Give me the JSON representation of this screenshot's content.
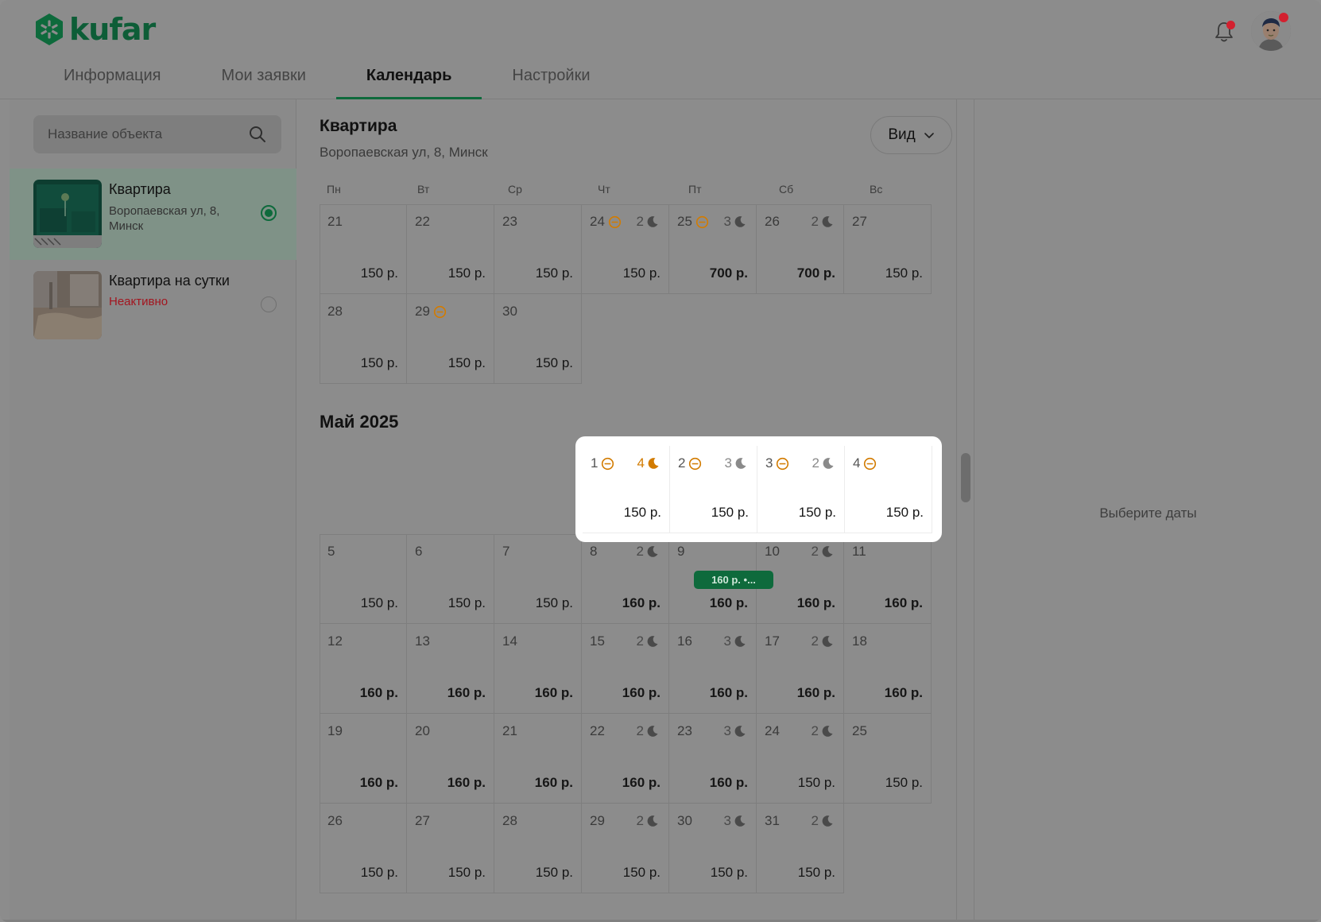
{
  "brand": {
    "name": "kufar",
    "color": "#0e6a3c"
  },
  "tabs": [
    {
      "label": "Информация",
      "active": false
    },
    {
      "label": "Мои заявки",
      "active": false
    },
    {
      "label": "Календарь",
      "active": true
    },
    {
      "label": "Настройки",
      "active": false
    }
  ],
  "sidebar": {
    "search_placeholder": "Название объекта",
    "objects": [
      {
        "title": "Квартира",
        "subtitle": "Воропаевская ул, 8, Минск",
        "selected": true
      },
      {
        "title": "Квартира на сутки",
        "status": "Неактивно",
        "selected": false
      }
    ]
  },
  "main": {
    "title": "Квартира",
    "address": "Воропаевская ул, 8, Минск",
    "view_label": "Вид",
    "weekdays": [
      "Пн",
      "Вт",
      "Ср",
      "Чт",
      "Пт",
      "Сб",
      "Вс"
    ],
    "month_title": "Май 2025",
    "badge_text": "160 р. •...",
    "april_rows": [
      [
        {
          "day": "21",
          "price": "150 р."
        },
        {
          "day": "22",
          "price": "150 р."
        },
        {
          "day": "23",
          "price": "150 р."
        },
        {
          "day": "24",
          "blocked": true,
          "nights": "2",
          "price": "150 р."
        },
        {
          "day": "25",
          "blocked": true,
          "nights": "3",
          "price": "700 р.",
          "bold": true
        },
        {
          "day": "26",
          "nights": "2",
          "price": "700 р.",
          "bold": true
        },
        {
          "day": "27",
          "price": "150 р."
        }
      ],
      [
        {
          "day": "28",
          "price": "150 р."
        },
        {
          "day": "29",
          "blocked": true,
          "price": "150 р."
        },
        {
          "day": "30",
          "price": "150 р."
        }
      ]
    ],
    "may_first_row": [
      {
        "day": "1",
        "blocked": true,
        "nights": "4",
        "nights_highlight": true,
        "price": "150 р."
      },
      {
        "day": "2",
        "blocked": true,
        "nights": "3",
        "price": "150 р."
      },
      {
        "day": "3",
        "blocked": true,
        "nights": "2",
        "price": "150 р."
      },
      {
        "day": "4",
        "blocked": true,
        "price": "150 р."
      }
    ],
    "may_rows": [
      [
        {
          "day": "5",
          "price": "150 р."
        },
        {
          "day": "6",
          "price": "150 р."
        },
        {
          "day": "7",
          "price": "150 р."
        },
        {
          "day": "8",
          "nights": "2",
          "price": "160 р.",
          "bold": true
        },
        {
          "day": "9",
          "price": "160 р.",
          "bold": true
        },
        {
          "day": "10",
          "nights": "2",
          "price": "160 р.",
          "bold": true
        },
        {
          "day": "11",
          "price": "160 р.",
          "bold": true
        }
      ],
      [
        {
          "day": "12",
          "price": "160 р.",
          "bold": true
        },
        {
          "day": "13",
          "price": "160 р.",
          "bold": true
        },
        {
          "day": "14",
          "price": "160 р.",
          "bold": true
        },
        {
          "day": "15",
          "nights": "2",
          "price": "160 р.",
          "bold": true
        },
        {
          "day": "16",
          "nights": "3",
          "price": "160 р.",
          "bold": true
        },
        {
          "day": "17",
          "nights": "2",
          "price": "160 р.",
          "bold": true
        },
        {
          "day": "18",
          "price": "160 р.",
          "bold": true
        }
      ],
      [
        {
          "day": "19",
          "price": "160 р.",
          "bold": true
        },
        {
          "day": "20",
          "price": "160 р.",
          "bold": true
        },
        {
          "day": "21",
          "price": "160 р.",
          "bold": true
        },
        {
          "day": "22",
          "nights": "2",
          "price": "160 р.",
          "bold": true
        },
        {
          "day": "23",
          "nights": "3",
          "price": "160 р.",
          "bold": true
        },
        {
          "day": "24",
          "nights": "2",
          "price": "150 р."
        },
        {
          "day": "25",
          "price": "150 р."
        }
      ],
      [
        {
          "day": "26",
          "price": "150 р."
        },
        {
          "day": "27",
          "price": "150 р."
        },
        {
          "day": "28",
          "price": "150 р."
        },
        {
          "day": "29",
          "nights": "2",
          "price": "150 р."
        },
        {
          "day": "30",
          "nights": "3",
          "price": "150 р."
        },
        {
          "day": "31",
          "nights": "2",
          "price": "150 р."
        }
      ]
    ]
  },
  "right_panel": {
    "hint": "Выберите даты"
  },
  "colors": {
    "blocked_icon": "#d27b00",
    "badge_bg": "#0e6a3c",
    "notification_dot": "#d3202f"
  }
}
